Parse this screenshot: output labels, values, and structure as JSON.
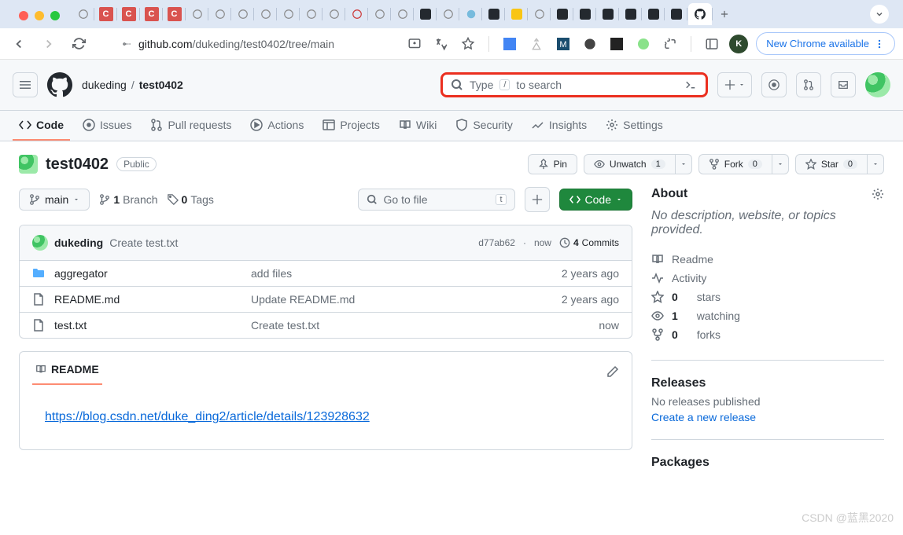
{
  "browser": {
    "url_domain": "github.com",
    "url_path": "/dukeding/test0402/tree/main",
    "update_label": "New Chrome available",
    "avatar_letter": "K"
  },
  "header": {
    "owner": "dukeding",
    "repo": "test0402",
    "search_prefix": "Type",
    "search_slash": "/",
    "search_suffix": "to search"
  },
  "nav": {
    "code": "Code",
    "issues": "Issues",
    "pulls": "Pull requests",
    "actions": "Actions",
    "projects": "Projects",
    "wiki": "Wiki",
    "security": "Security",
    "insights": "Insights",
    "settings": "Settings"
  },
  "repo": {
    "name": "test0402",
    "visibility": "Public",
    "pin": "Pin",
    "unwatch": "Unwatch",
    "watch_count": "1",
    "fork": "Fork",
    "fork_count": "0",
    "star": "Star",
    "star_count": "0"
  },
  "toolbar": {
    "branch": "main",
    "branches_count": "1",
    "branches_label": "Branch",
    "tags_count": "0",
    "tags_label": "Tags",
    "goto_placeholder": "Go to file",
    "goto_kbd": "t",
    "code_btn": "Code"
  },
  "commit": {
    "author": "dukeding",
    "message": "Create test.txt",
    "sha": "d77ab62",
    "dot": "·",
    "time": "now",
    "commits_count": "4",
    "commits_label": "Commits"
  },
  "files": [
    {
      "type": "folder",
      "name": "aggregator",
      "msg": "add files",
      "time": "2 years ago"
    },
    {
      "type": "file",
      "name": "README.md",
      "msg": "Update README.md",
      "time": "2 years ago"
    },
    {
      "type": "file",
      "name": "test.txt",
      "msg": "Create test.txt",
      "time": "now"
    }
  ],
  "readme": {
    "label": "README",
    "link": "https://blog.csdn.net/duke_ding2/article/details/123928632"
  },
  "sidebar": {
    "about": "About",
    "desc": "No description, website, or topics provided.",
    "readme": "Readme",
    "activity": "Activity",
    "stars_n": "0",
    "stars_t": "stars",
    "watching_n": "1",
    "watching_t": "watching",
    "forks_n": "0",
    "forks_t": "forks",
    "releases": "Releases",
    "no_releases": "No releases published",
    "create_release": "Create a new release",
    "packages": "Packages"
  },
  "watermark": "CSDN @蓝黑2020"
}
